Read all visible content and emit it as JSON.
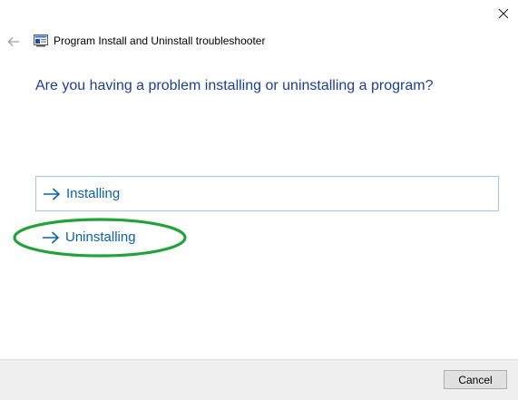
{
  "window": {
    "title": "Program Install and Uninstall troubleshooter",
    "close_icon": "close-icon",
    "back_icon": "back-arrow-icon"
  },
  "main": {
    "question": "Are you having a problem installing or uninstalling a program?",
    "options": [
      {
        "label": "Installing",
        "icon": "right-arrow-icon",
        "state": "hover"
      },
      {
        "label": "Uninstalling",
        "icon": "right-arrow-icon",
        "annotation": "green circle highlight"
      }
    ]
  },
  "footer": {
    "cancel_label": "Cancel"
  },
  "colors": {
    "question_text": "#1c3f94",
    "option_text": "#0b62a8",
    "option_hover_border": "#9fc6e6",
    "highlight_ring": "#22a33a",
    "footer_bg": "#f0f0f0"
  }
}
